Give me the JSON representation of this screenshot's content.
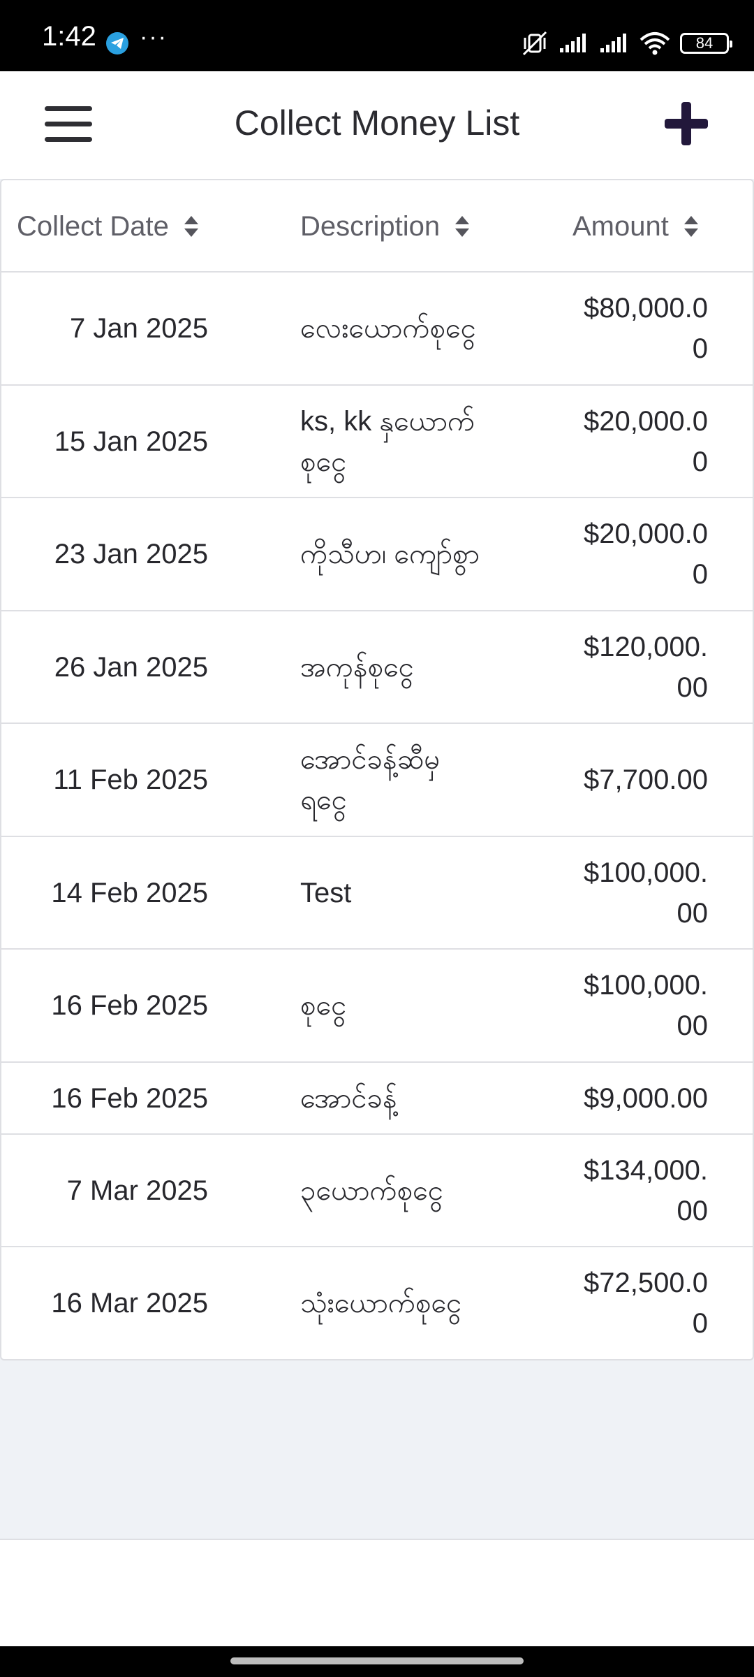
{
  "status_bar": {
    "time": "1:42",
    "dots": "···",
    "battery": "84",
    "icons": [
      "telegram-icon",
      "mute-vibrate-icon",
      "signal-icon",
      "signal-icon",
      "wifi-icon",
      "battery-icon"
    ]
  },
  "header": {
    "title": "Collect Money List",
    "menu_icon": "hamburger-menu-icon",
    "add_icon": "plus-icon"
  },
  "table": {
    "columns": [
      "Collect Date",
      "Description",
      "Amount"
    ],
    "rows": [
      {
        "date": "7 Jan 2025",
        "description": "လေးယောက်စုငွေ",
        "amount": "$80,000.00"
      },
      {
        "date": "15 Jan 2025",
        "description": "ks, kk နှယောက်စုငွေ",
        "amount": "$20,000.00"
      },
      {
        "date": "23 Jan 2025",
        "description": "ကိုသီဟ၊ ကျော်စွာ",
        "amount": "$20,000.00"
      },
      {
        "date": "26 Jan 2025",
        "description": "အကုန်စုငွေ",
        "amount": "$120,000.00"
      },
      {
        "date": "11 Feb 2025",
        "description": "အောင်ခန့်ဆီမှရငွေ",
        "amount": "$7,700.00"
      },
      {
        "date": "14 Feb 2025",
        "description": "Test",
        "amount": "$100,000.00"
      },
      {
        "date": "16 Feb 2025",
        "description": "စုငွေ",
        "amount": "$100,000.00"
      },
      {
        "date": "16 Feb 2025",
        "description": "အောင်ခန့်",
        "amount": "$9,000.00"
      },
      {
        "date": "7 Mar 2025",
        "description": "၃ယောက်စုငွေ",
        "amount": "$134,000.00"
      },
      {
        "date": "16 Mar 2025",
        "description": "သုံးယောက်စုငွေ",
        "amount": "$72,500.00"
      }
    ]
  }
}
